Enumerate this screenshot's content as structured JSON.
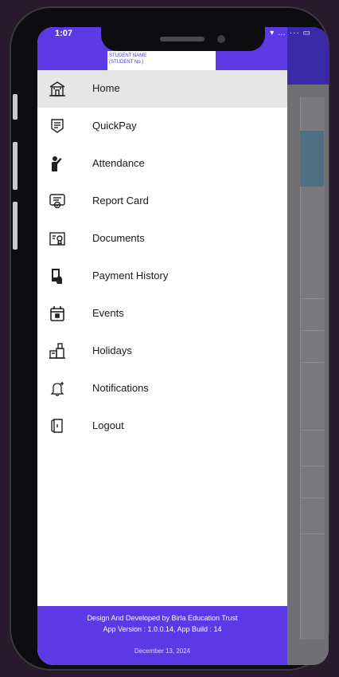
{
  "status_bar": {
    "time": "1:07",
    "icons": "▾ … ··· ▭"
  },
  "drawer": {
    "student_name": "STUDENT NAME",
    "student_no": "(STUDENT No.)",
    "items": [
      {
        "label": "Home",
        "icon": "home-icon",
        "active": true
      },
      {
        "label": "QuickPay",
        "icon": "quickpay-icon",
        "active": false
      },
      {
        "label": "Attendance",
        "icon": "attendance-icon",
        "active": false
      },
      {
        "label": "Report Card",
        "icon": "report-card-icon",
        "active": false
      },
      {
        "label": "Documents",
        "icon": "documents-icon",
        "active": false
      },
      {
        "label": "Payment History",
        "icon": "payment-history-icon",
        "active": false
      },
      {
        "label": "Events",
        "icon": "events-icon",
        "active": false
      },
      {
        "label": "Holidays",
        "icon": "holidays-icon",
        "active": false
      },
      {
        "label": "Notifications",
        "icon": "notifications-icon",
        "active": false
      },
      {
        "label": "Logout",
        "icon": "logout-icon",
        "active": false
      }
    ],
    "footer": {
      "credit": "Design And Developed by Birla Education Trust",
      "version": "App Version : 1.0.0.14, App Build : 14",
      "date": "December 13, 2024"
    }
  },
  "colors": {
    "brand": "#5b3ae6",
    "active_bg": "#e6e6e6",
    "text": "#1a1a1a"
  }
}
